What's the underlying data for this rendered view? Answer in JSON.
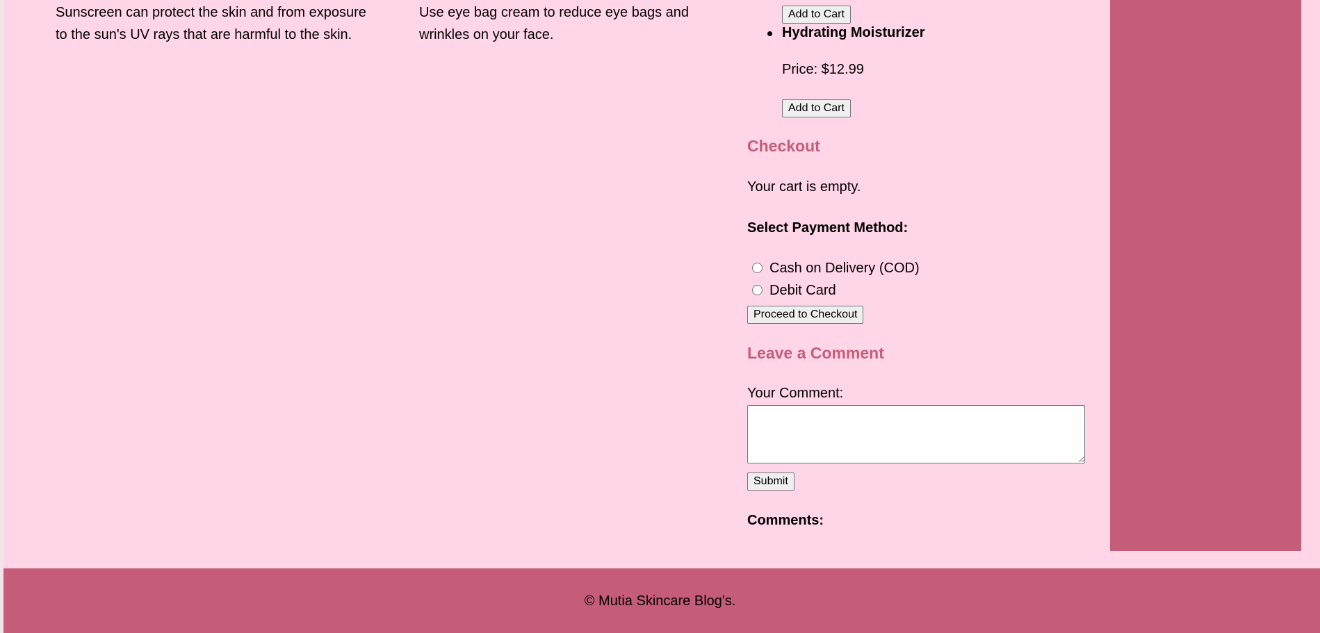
{
  "articles": [
    {
      "text": "Sunscreen can protect the skin and from exposure to the sun's UV rays that are harmful to the skin."
    },
    {
      "text": "Use eye bag cream to reduce eye bags and wrinkles on your face."
    }
  ],
  "products": {
    "add_to_cart_label": "Add to Cart",
    "items": [
      {
        "name": "Hydrating Moisturizer",
        "price": "Price: $12.99"
      }
    ]
  },
  "checkout": {
    "heading": "Checkout",
    "cart_status": "Your cart is empty.",
    "payment_label": "Select Payment Method:",
    "options": [
      "Cash on Delivery (COD)",
      "Debit Card"
    ],
    "proceed_label": "Proceed to Checkout"
  },
  "comments": {
    "heading": "Leave a Comment",
    "field_label": "Your Comment:",
    "field_value": "",
    "submit_label": "Submit",
    "list_label": "Comments:"
  },
  "footer": {
    "text": "© Mutia Skincare Blog's."
  },
  "colors": {
    "background": "#ffd6e8",
    "accent": "#c55c7a"
  }
}
